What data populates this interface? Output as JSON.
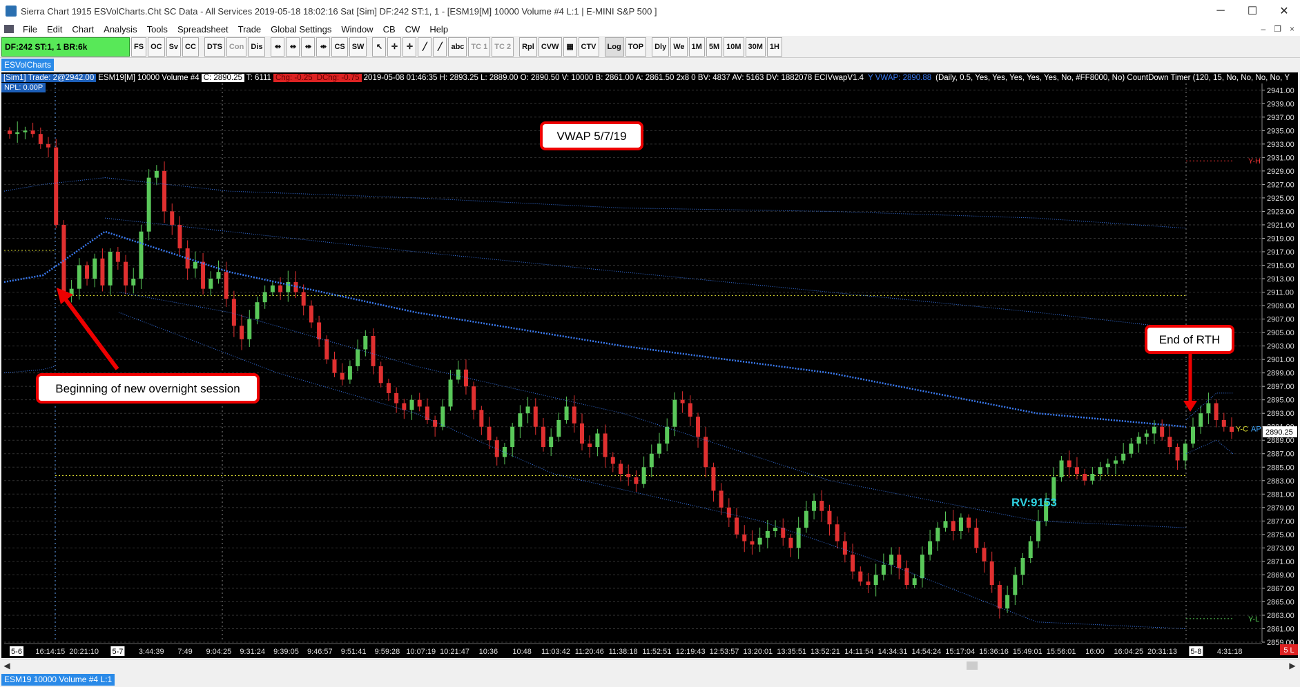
{
  "window": {
    "title": "Sierra Chart 1915 ESVolCharts.Cht  SC Data - All Services 2019-05-18  18:02:16 Sat [Sim]  DF:242  ST:1, 1 - [ESM19[M]  10000 Volume  #4  L:1 | E-MINI S&P 500 ]",
    "minimize": "─",
    "maximize": "☐",
    "close": "✕"
  },
  "menu": [
    "File",
    "Edit",
    "Chart",
    "Analysis",
    "Tools",
    "Spreadsheet",
    "Trade",
    "Global Settings",
    "Window",
    "CB",
    "CW",
    "Help"
  ],
  "menu_right": [
    "–",
    "❐",
    "×"
  ],
  "toolbar": {
    "df_box": "DF:242  ST:1, 1  BR:6k",
    "buttons": [
      "FS",
      "OC",
      "Sv",
      "CC",
      "DTS",
      "Con",
      "Dis",
      "⇹",
      "⇹",
      "⇹",
      "⇹",
      "CS",
      "SW",
      "↖",
      "✛",
      "✛",
      "╱",
      "╱",
      "abc",
      "TC 1",
      "TC 2",
      "Rpl",
      "CVW",
      "▦",
      "CTV",
      "Log",
      "TOP",
      "Dly",
      "We",
      "1M",
      "5M",
      "10M",
      "30M",
      "1H"
    ]
  },
  "tab": "ESVolCharts",
  "infobar": {
    "sim": "[Sim1]  Trade: 2@2942.00",
    "symbol": "ESM19[M]  10000 Volume  #4",
    "close": "C: 2890.25",
    "ticks": "T: 6111",
    "chg": "Chg: -0.25",
    "dchg": "DChg: -0.75",
    "details": "2019-05-08 01:46:35 H: 2893.25 L: 2889.00 O: 2890.50 V: 10000 B: 2861.00 A: 2861.50 2x8 0 BV: 4837 AV: 5163 DV: 1882078 ECIVwapV1.4",
    "vwap": "Y VWAP: 2890.88",
    "study": "(Daily, 0.5, Yes, Yes, Yes, Yes, Yes, No, #FF8000, No)  CountDown Timer  (120, 15, No, No, No, No, Y"
  },
  "npl": "NPL: 0.00P",
  "annotations": {
    "vwap_label": "VWAP 5/7/19",
    "end_rth": "End of RTH",
    "beginning": "Beginning of new overnight session",
    "rv": "RV:9153"
  },
  "level_labels": {
    "yh": "Y-H",
    "yc": "Y-C",
    "ap": "AP",
    "yl": "Y-L"
  },
  "price_axis": {
    "labels": [
      "2941.00",
      "2939.00",
      "2937.00",
      "2935.00",
      "2933.00",
      "2931.00",
      "2929.00",
      "2927.00",
      "2925.00",
      "2923.00",
      "2921.00",
      "2919.00",
      "2917.00",
      "2915.00",
      "2913.00",
      "2911.00",
      "2909.00",
      "2907.00",
      "2905.00",
      "2903.00",
      "2901.00",
      "2899.00",
      "2897.00",
      "2895.00",
      "2893.00",
      "2891.00",
      "2889.00",
      "2887.00",
      "2885.00",
      "2883.00",
      "2881.00",
      "2879.00",
      "2877.00",
      "2875.00",
      "2873.00",
      "2871.00",
      "2869.00",
      "2867.00",
      "2865.00",
      "2863.00",
      "2861.00",
      "2859.00"
    ],
    "current": "2890.25"
  },
  "time_axis": [
    "5-6",
    "16:14:15",
    "20:21:10",
    "5-7",
    "3:44:39",
    "7:49",
    "9:04:25",
    "9:31:24",
    "9:39:05",
    "9:46:57",
    "9:51:41",
    "9:59:28",
    "10:07:19",
    "10:21:47",
    "10:36",
    "10:48",
    "11:03:42",
    "11:20:46",
    "11:38:18",
    "11:52:51",
    "12:19:43",
    "12:53:57",
    "13:20:01",
    "13:35:51",
    "13:52:21",
    "14:11:54",
    "14:34:31",
    "14:54:24",
    "15:17:04",
    "15:36:16",
    "15:49:01",
    "15:56:01",
    "16:00",
    "16:04:25",
    "20:31:13",
    "5-8",
    "4:31:18"
  ],
  "status": "ESM19  10000 Volume  #4  L:1",
  "status_right": "5 L",
  "colors": {
    "up": "#5ac85a",
    "down": "#e03030",
    "vwap": "#3a7af0",
    "level": "#d8d830",
    "axis_bg": "#000000"
  },
  "chart_data": {
    "type": "candlestick",
    "ylim": [
      2859,
      2942
    ],
    "closes": [
      2934.5,
      2934.75,
      2935.0,
      2934.5,
      2933.0,
      2932.5,
      2921.0,
      2910.5,
      2911.5,
      2915.0,
      2913.0,
      2916.0,
      2912.0,
      2917.0,
      2915.5,
      2912.0,
      2913.0,
      2920.0,
      2928.0,
      2929.0,
      2923.0,
      2921.0,
      2917.5,
      2914.5,
      2915.5,
      2911.5,
      2913.0,
      2914.0,
      2910.0,
      2906.0,
      2904.0,
      2907.0,
      2909.5,
      2911.0,
      2912.0,
      2911.0,
      2912.5,
      2911.0,
      2909.0,
      2906.5,
      2904.0,
      2901.0,
      2899.0,
      2898.0,
      2900.0,
      2902.5,
      2904.5,
      2900.0,
      2897.5,
      2896.0,
      2894.5,
      2893.5,
      2895.0,
      2894.0,
      2892.0,
      2891.0,
      2894.0,
      2898.0,
      2899.5,
      2897.0,
      2893.5,
      2891.0,
      2889.0,
      2886.5,
      2888.0,
      2891.0,
      2893.0,
      2894.0,
      2891.0,
      2888.0,
      2889.5,
      2892.0,
      2894.0,
      2891.5,
      2888.5,
      2888.0,
      2890.0,
      2886.5,
      2885.5,
      2884.0,
      2883.5,
      2882.5,
      2885.0,
      2887.0,
      2888.5,
      2891.0,
      2895.0,
      2894.5,
      2892.5,
      2889.5,
      2885.0,
      2881.5,
      2879.0,
      2877.5,
      2875.0,
      2874.0,
      2873.5,
      2874.5,
      2875.5,
      2876.0,
      2874.5,
      2873.0,
      2876.0,
      2878.5,
      2880.0,
      2878.5,
      2876.5,
      2874.0,
      2872.0,
      2869.5,
      2868.0,
      2867.5,
      2869.0,
      2870.5,
      2872.0,
      2870.0,
      2867.5,
      2868.5,
      2872.0,
      2874.0,
      2876.0,
      2877.0,
      2875.5,
      2877.5,
      2876.0,
      2873.0,
      2871.0,
      2867.5,
      2864.0,
      2866.0,
      2869.0,
      2871.5,
      2874.0,
      2877.0,
      2880.0,
      2883.5,
      2886.0,
      2885.0,
      2884.0,
      2883.0,
      2884.0,
      2885.0,
      2885.5,
      2886.0,
      2887.0,
      2888.5,
      2889.5,
      2890.0,
      2891.0,
      2889.5,
      2888.0,
      2886.0,
      2888.5,
      2891.0,
      2893.0,
      2894.5,
      2892.0,
      2891.0,
      2890.25
    ]
  }
}
